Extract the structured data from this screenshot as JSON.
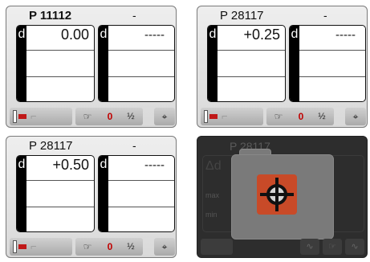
{
  "screens": [
    {
      "program": "P 11112",
      "separator": "-",
      "left_label": "d",
      "left_value": "0.00",
      "right_label": "d",
      "right_value": "-----",
      "toolbar": {
        "zero": "0",
        "half": "½"
      }
    },
    {
      "program": "P 28117",
      "separator": "-",
      "left_label": "d",
      "left_value": "+0.25",
      "right_label": "d",
      "right_value": "-----",
      "toolbar": {
        "zero": "0",
        "half": "½"
      }
    },
    {
      "program": "P 28117",
      "separator": "-",
      "left_label": "d",
      "left_value": "+0.50",
      "right_label": "d",
      "right_value": "-----",
      "toolbar": {
        "zero": "0",
        "half": "½"
      }
    },
    {
      "program": "P 28117",
      "delta_label": "Δd",
      "max_label": "max",
      "min_label": "min",
      "dialog_icon": "target-icon"
    }
  ],
  "icons": [
    "exit-door-icon",
    "probe-icon",
    "hand-icon",
    "half-icon",
    "crosshair-icon",
    "target-icon"
  ],
  "colors": {
    "zero": "#c00000",
    "strip": "#000000",
    "target": "#c84a28",
    "dark_bg": "#2d2d2d"
  }
}
